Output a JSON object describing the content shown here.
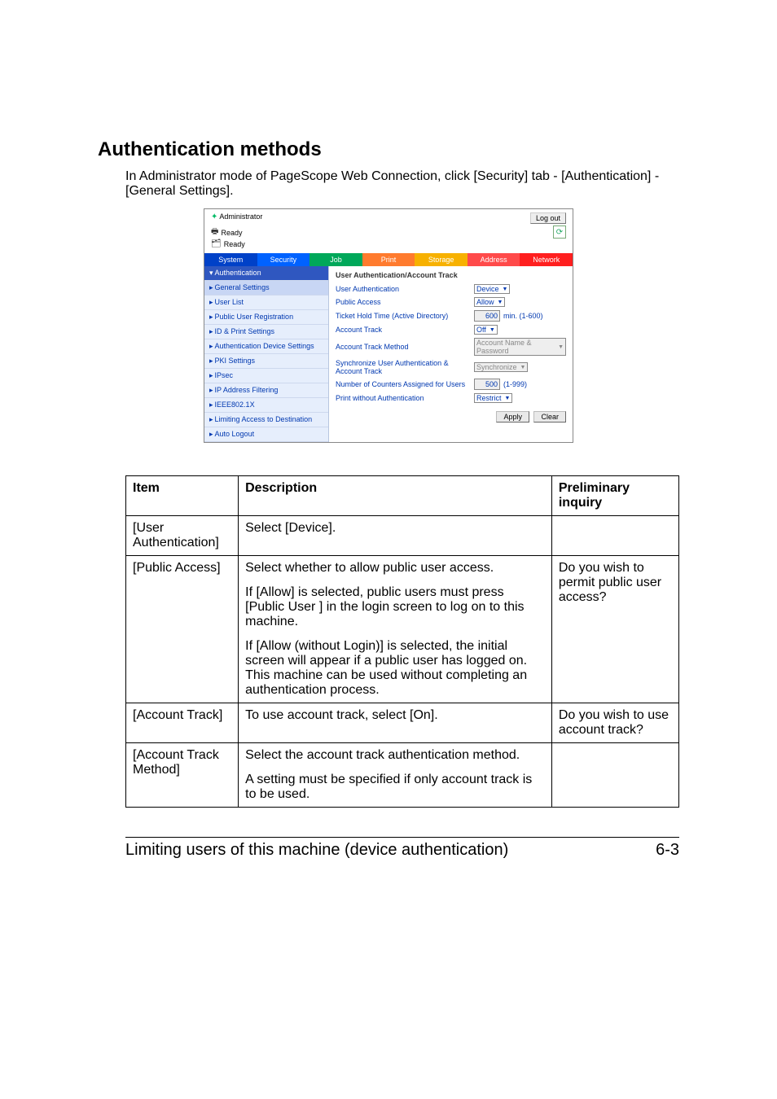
{
  "heading": "Authentication methods",
  "intro": "In Administrator mode of PageScope Web Connection, click [Security] tab - [Authentication] - [General Settings].",
  "screenshot": {
    "admin_label": "Administrator",
    "logout": "Log out",
    "status1": "Ready",
    "status2": "Ready",
    "tabs": [
      "System",
      "Security",
      "Job",
      "Print",
      "Storage",
      "Address",
      "Network"
    ],
    "sidebar": {
      "header": "Authentication",
      "items": [
        "General Settings",
        "User List",
        "Public User Registration",
        "ID & Print Settings",
        "Authentication Device Settings",
        "PKI Settings",
        "IPsec",
        "IP Address Filtering",
        "IEEE802.1X",
        "Limiting Access to Destination",
        "Auto Logout"
      ]
    },
    "section_title": "User Authentication/Account Track",
    "rows": {
      "user_auth": {
        "label": "User Authentication",
        "value": "Device"
      },
      "public_access": {
        "label": "Public Access",
        "value": "Allow"
      },
      "ticket": {
        "label": "Ticket Hold Time (Active Directory)",
        "value": "600",
        "suffix": "min. (1-600)"
      },
      "acct_track": {
        "label": "Account Track",
        "value": "Off"
      },
      "acct_method": {
        "label": "Account Track Method",
        "value": "Account Name & Password"
      },
      "sync_label": "Synchronize User Authentication & Account Track",
      "sync_value": "Synchronize",
      "counters": {
        "label": "Number of Counters Assigned for Users",
        "value": "500",
        "suffix": "(1-999)"
      },
      "print_without": {
        "label": "Print without Authentication",
        "value": "Restrict"
      }
    },
    "apply": "Apply",
    "clear": "Clear"
  },
  "table": {
    "headers": [
      "Item",
      "Description",
      "Preliminary inquiry"
    ],
    "r1": {
      "item": "[User Authentication]",
      "desc": "Select [Device].",
      "inq": ""
    },
    "r2": {
      "item": "[Public Access]",
      "desc_p1": "Select whether to allow public user access.",
      "desc_p2": "If [Allow] is selected, public users must press [Public User ] in the login screen to log on to this machine.",
      "desc_p3": "If [Allow (without Login)] is selected, the initial screen will appear if a public user has logged on. This machine can be used without completing an authentication process.",
      "inq": "Do you wish to permit public user access?"
    },
    "r3": {
      "item": "[Account Track]",
      "desc": "To use account track, select [On].",
      "inq": "Do you wish to use account track?"
    },
    "r4": {
      "item": "[Account Track Method]",
      "desc_p1": "Select the account track authentication method.",
      "desc_p2": "A setting must be specified if only account track is to be used.",
      "inq": ""
    }
  },
  "footer": {
    "title": "Limiting users of this machine (device authentication)",
    "page": "6-3"
  }
}
